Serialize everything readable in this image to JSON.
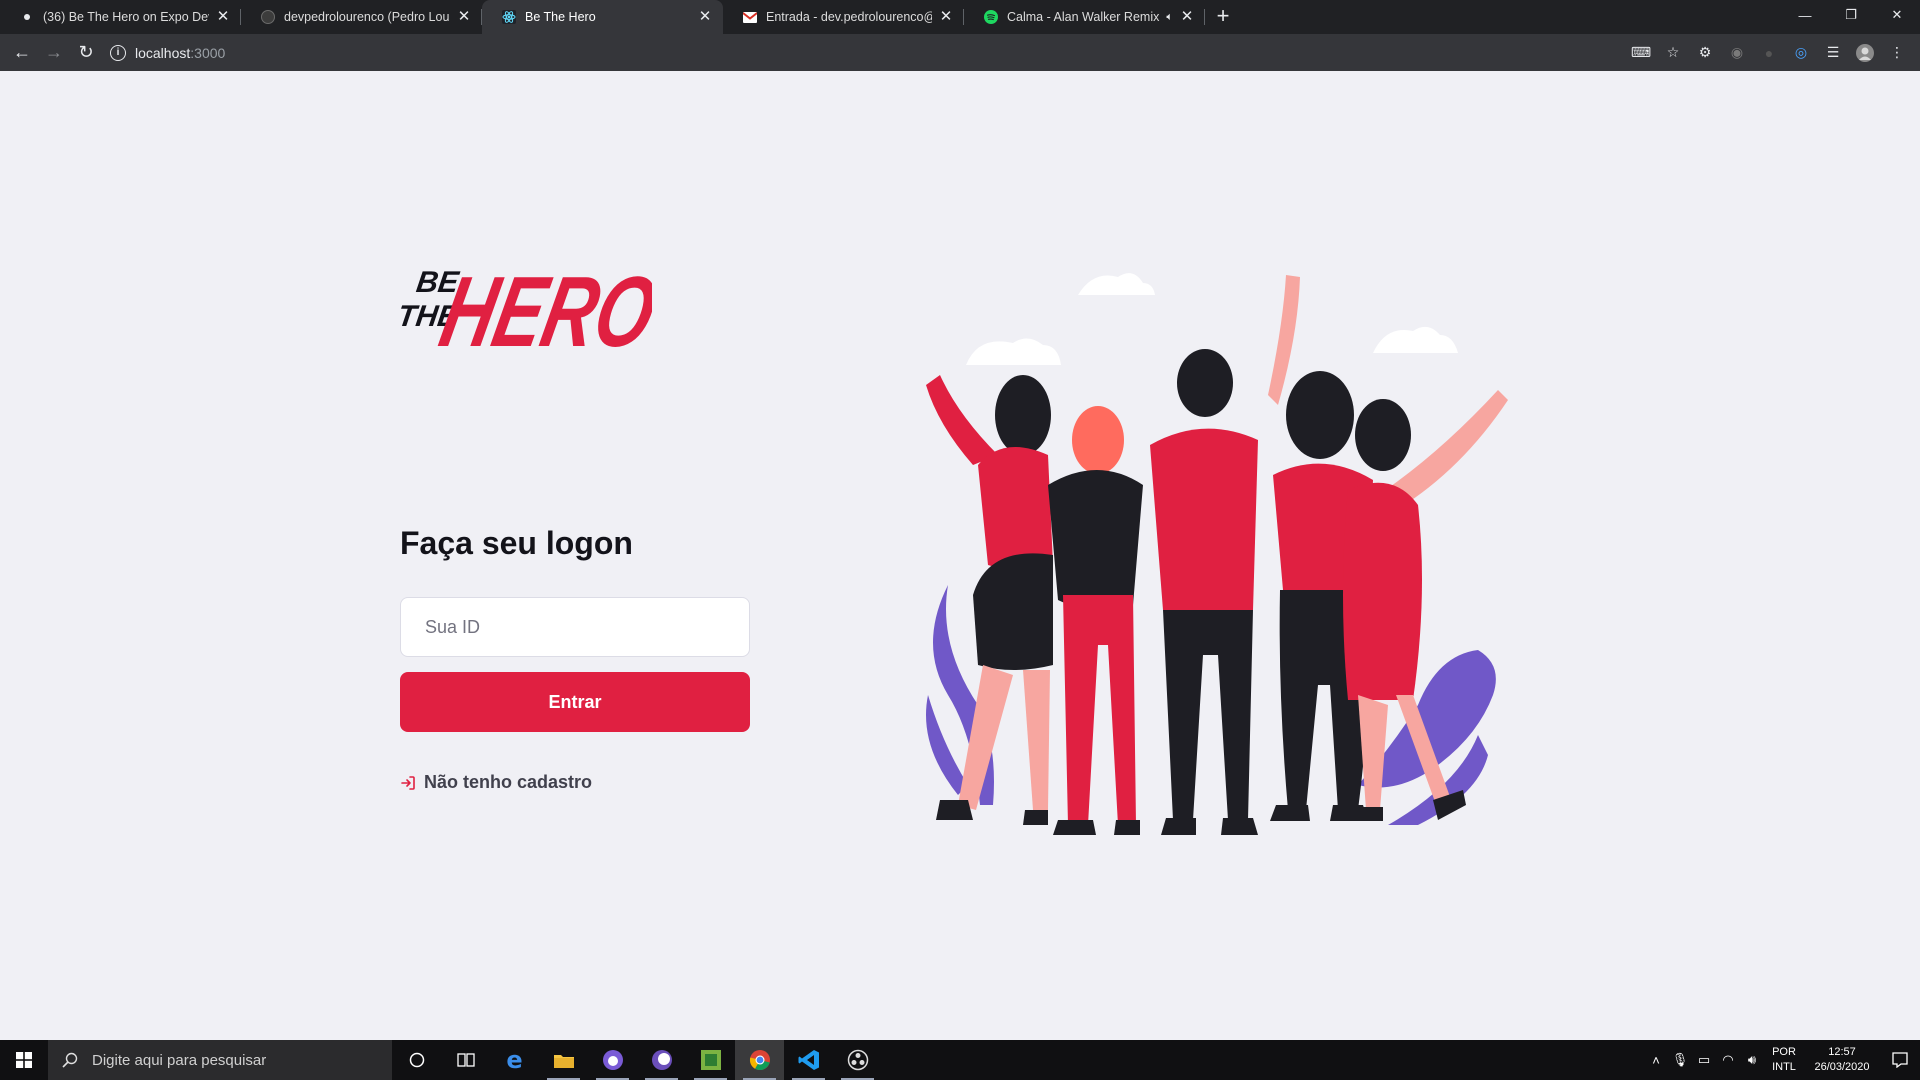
{
  "browser": {
    "tabs": [
      {
        "title": "(36) Be The Hero on Expo Develo",
        "icon": "dot-icon"
      },
      {
        "title": "devpedrolourenco (Pedro Louren",
        "icon": "github-icon"
      },
      {
        "title": "Be The Hero",
        "icon": "react-icon",
        "active": true
      },
      {
        "title": "Entrada - dev.pedrolourenco@gr",
        "icon": "gmail-icon"
      },
      {
        "title": "Calma - Alan Walker Remix -",
        "icon": "spotify-icon",
        "audio": true
      }
    ],
    "url_host": "localhost",
    "url_port": ":3000"
  },
  "page": {
    "logo_alt": "BE THE HERO",
    "logo": {
      "line1": "BE",
      "line2": "THE",
      "word": "HERO"
    },
    "title": "Faça seu logon",
    "id_placeholder": "Sua ID",
    "enter_label": "Entrar",
    "register_label": "Não tenho cadastro"
  },
  "colors": {
    "brand": "#e02041",
    "background": "#f0f0f5",
    "text_dark": "#13131a"
  },
  "taskbar": {
    "search_placeholder": "Digite aqui para pesquisar",
    "lang_line1": "POR",
    "lang_line2": "INTL",
    "time": "12:57",
    "date": "26/03/2020"
  }
}
